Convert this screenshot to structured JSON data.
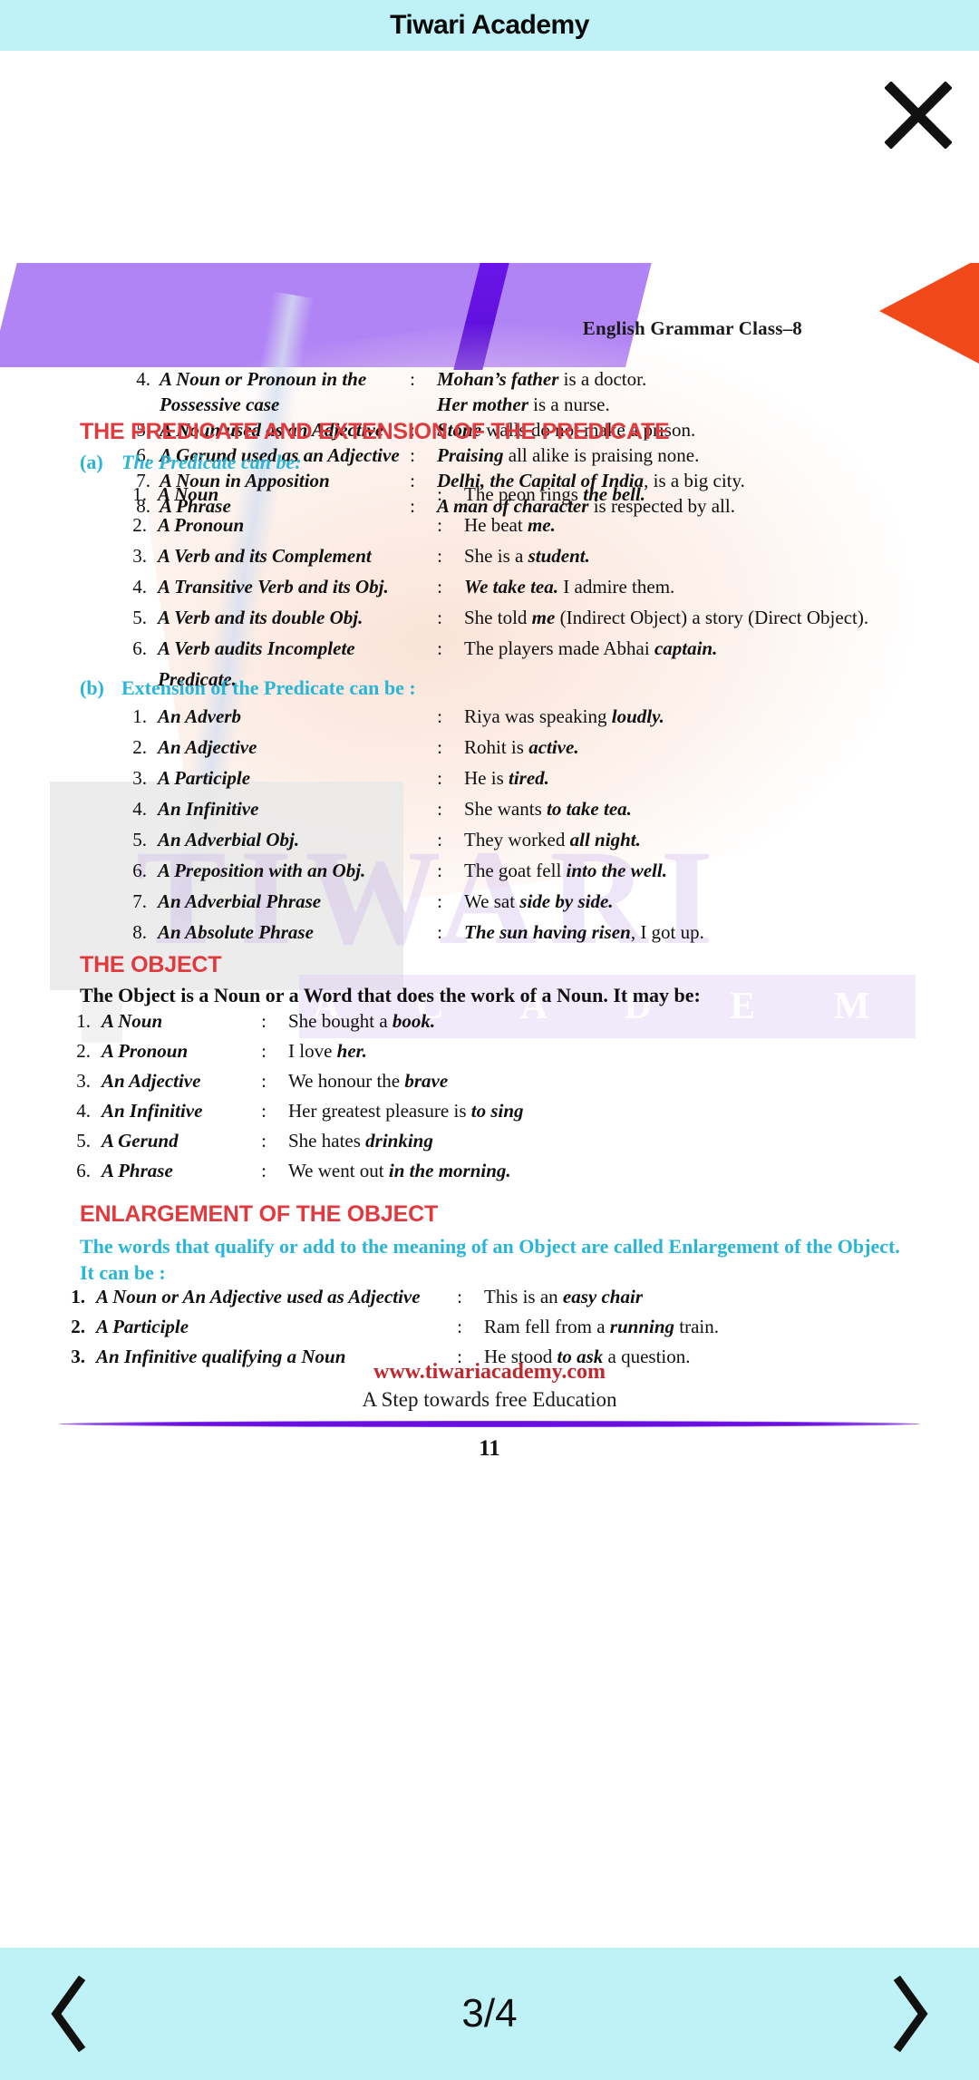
{
  "topbar": {
    "title": "Tiwari Academy",
    "close_icon": "close-icon"
  },
  "document": {
    "header_label": "English Grammar Class–8",
    "watermark_line1": "TIWARI",
    "watermark_line2": "A C A D E M Y",
    "top_list": [
      {
        "num": "4.",
        "label": "A Noun or Pronoun in the",
        "label_cont": "Possessive case",
        "colon": ":",
        "example_html": "<i>Mohan’s father</i> is a doctor.",
        "example_cont_html": "<i>Her mother</i> is a nurse."
      },
      {
        "num": "5.",
        "label": "A Noun used as an Adjective",
        "colon": ":",
        "example_html": "<i>Stone</i> walls do not make a prison."
      },
      {
        "num": "6.",
        "label": "A Gerund used as an Adjective",
        "colon": ":",
        "example_html": "<i>Praising</i> all alike is praising none."
      },
      {
        "num": "7.",
        "label": "A Noun in Apposition",
        "colon": ":",
        "example_html": "<i>Delhi, the Capital of India</i>, is a big city."
      },
      {
        "num": "8.",
        "label": "A Phrase",
        "colon": ":",
        "example_html": "<i>A man of character</i> is respected by all."
      }
    ],
    "heading_predicate": "THE PREDICATE AND EXTENSION OF THE PREDICATE",
    "sub_a_tag": "(a)",
    "sub_a_text": "The Predicate can be:",
    "predicate_list": [
      {
        "num": "1.",
        "label": "A Noun",
        "colon": ":",
        "example_html": "The peon rings <i>the bell.</i>"
      },
      {
        "num": "2.",
        "label": "A Pronoun",
        "colon": ":",
        "example_html": "He beat <i>me.</i>"
      },
      {
        "num": "3.",
        "label": "A Verb and its Complement",
        "colon": ":",
        "example_html": "She is a <i>student.</i>"
      },
      {
        "num": "4.",
        "label": "A Transitive Verb and its Obj.",
        "colon": ":",
        "example_html": "<i>We take tea.</i> I admire them."
      },
      {
        "num": "5.",
        "label": "A Verb and its double Obj.",
        "colon": ":",
        "example_html": "She told <i>me</i> (Indirect Object) a story (Direct Object)."
      },
      {
        "num": "6.",
        "label": "A Verb audits Incomplete",
        "label_cont": "Predicate.",
        "colon": ":",
        "example_html": "The players made Abhai <i>captain.</i>"
      }
    ],
    "sub_b_tag": "(b)",
    "sub_b_text": "Extension of the Predicate can be :",
    "extension_list": [
      {
        "num": "1.",
        "label": "An Adverb",
        "colon": ":",
        "example_html": "Riya was speaking <i>loudly.</i>"
      },
      {
        "num": "2.",
        "label": "An Adjective",
        "colon": ":",
        "example_html": "Rohit is <i>active.</i>"
      },
      {
        "num": "3.",
        "label": "A Participle",
        "colon": ":",
        "example_html": "He is <i>tired.</i>"
      },
      {
        "num": "4.",
        "label": "An Infinitive",
        "colon": ":",
        "example_html": "She wants <i>to take tea.</i>"
      },
      {
        "num": "5.",
        "label": "An Adverbial Obj.",
        "colon": ":",
        "example_html": "They worked <i>all night.</i>"
      },
      {
        "num": "6.",
        "label": "A Preposition with an Obj.",
        "colon": ":",
        "example_html": "The goat fell <i>into the well.</i>"
      },
      {
        "num": "7.",
        "label": "An Adverbial Phrase",
        "colon": ":",
        "example_html": "We sat <i>side by side.</i>"
      },
      {
        "num": "8.",
        "label": "An Absolute Phrase",
        "colon": ":",
        "example_html": "<i>The sun having risen</i>, I got up."
      }
    ],
    "heading_object": "THE OBJECT",
    "object_intro": "The Object is a Noun or a Word that does the work of a Noun. It may be:",
    "object_list": [
      {
        "num": "1.",
        "label": "A Noun",
        "colon": ":",
        "example_html": "She bought a <i>book.</i>"
      },
      {
        "num": "2.",
        "label": "A Pronoun",
        "colon": ":",
        "example_html": "I love <i>her.</i>"
      },
      {
        "num": "3.",
        "label": "An Adjective",
        "colon": ":",
        "example_html": "We honour the <i>brave</i>"
      },
      {
        "num": "4.",
        "label": "An Infinitive",
        "colon": ":",
        "example_html": "Her greatest pleasure is <i>to sing</i>"
      },
      {
        "num": "5.",
        "label": "A Gerund",
        "colon": ":",
        "example_html": "She hates <i>drinking</i>"
      },
      {
        "num": "6.",
        "label": "A Phrase",
        "colon": ":",
        "example_html": "We went out <i>in the morning.</i>"
      }
    ],
    "heading_enlargement": "ENLARGEMENT OF THE OBJECT",
    "enlargement_intro": "The words that qualify or add to the meaning of an Object are called Enlargement of the Object. It can be :",
    "enlargement_list": [
      {
        "num": "1.",
        "label": "A Noun or An Adjective used as Adjective",
        "colon": ":",
        "example_html": "This is an <i>easy chair</i>"
      },
      {
        "num": "2.",
        "label": "A Participle",
        "colon": ":",
        "example_html": "Ram fell from a <i>running</i> train."
      },
      {
        "num": "3.",
        "label": "An Infinitive qualifying a Noun",
        "colon": ":",
        "example_html": "He stood <i>to ask</i> a question."
      }
    ],
    "footer_site": "www.tiwariacademy.com",
    "footer_tagline": "A Step towards free Education",
    "page_number": "11"
  },
  "bottombar": {
    "prev_icon": "chevron-left-icon",
    "next_icon": "chevron-right-icon",
    "page_indicator": "3/4"
  },
  "colors": {
    "bar": "#bff2f7",
    "heading_red": "#e03a3f",
    "heading_cyan": "#28b5d8",
    "band_purple": "#b184f5",
    "band_stripe": "#6a14e8",
    "band_orange": "#f1491a",
    "site_red": "#c1272d",
    "rule_purple": "#6a0fe0"
  }
}
